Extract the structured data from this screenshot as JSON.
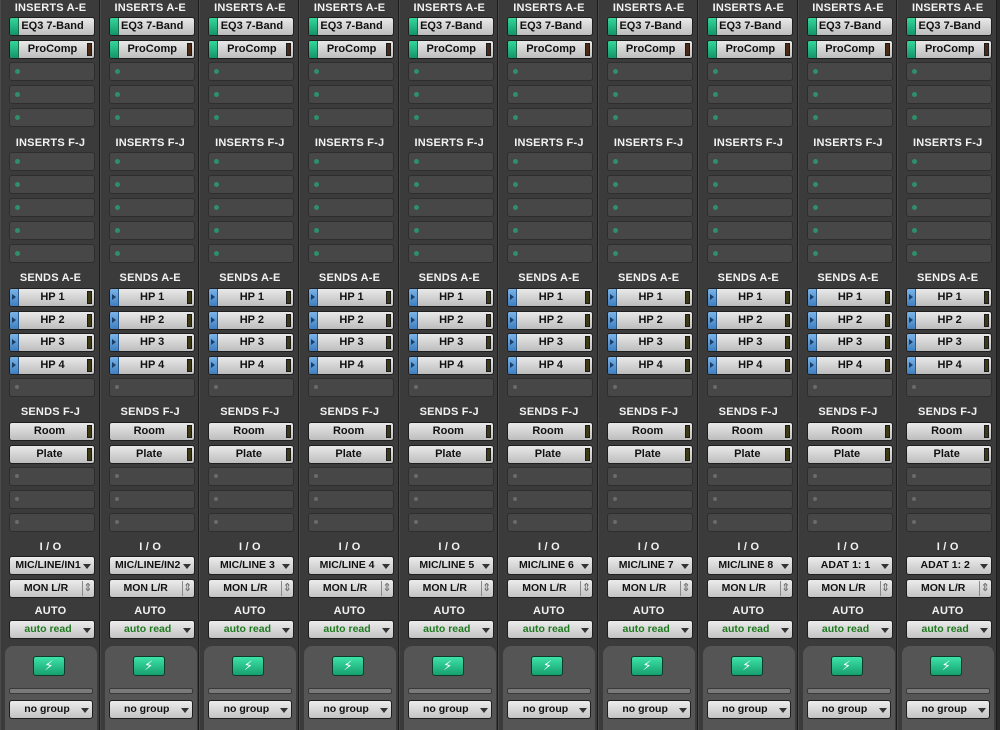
{
  "section_labels": {
    "inserts_ae": "INSERTS A-E",
    "inserts_fj": "INSERTS F-J",
    "sends_ae": "SENDS A-E",
    "sends_fj": "SENDS F-J",
    "io": "I / O",
    "auto": "AUTO"
  },
  "inserts": {
    "plugin1": "EQ3 7-Band",
    "plugin2": "ProComp"
  },
  "sends_ae": [
    "HP 1",
    "HP 2",
    "HP 3",
    "HP 4"
  ],
  "sends_fj": [
    "Room",
    "Plate"
  ],
  "channels": [
    {
      "input": "MIC/LINE/IN1"
    },
    {
      "input": "MIC/LINE/IN2"
    },
    {
      "input": "MIC/LINE 3"
    },
    {
      "input": "MIC/LINE 4"
    },
    {
      "input": "MIC/LINE 5"
    },
    {
      "input": "MIC/LINE 6"
    },
    {
      "input": "MIC/LINE 7"
    },
    {
      "input": "MIC/LINE 8"
    },
    {
      "input": "ADAT 1: 1"
    },
    {
      "input": "ADAT 1: 2"
    }
  ],
  "output": "MON L/R",
  "automation_mode": "auto read",
  "group": "no group",
  "power_icon": "lightning-bolt-icon",
  "colors": {
    "insert_tab": "#1fb57f",
    "send_tab": "#4f8fd0",
    "auto_text": "#1f7a1f"
  }
}
